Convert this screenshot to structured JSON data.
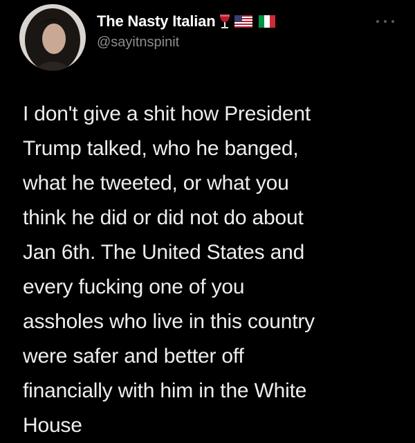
{
  "user": {
    "display_name": "The Nasty Italian",
    "handle": "@sayitnspinit",
    "name_emojis": [
      "wine-glass-icon",
      "us-flag-icon",
      "italy-flag-icon"
    ]
  },
  "tweet": {
    "lines": [
      "I don't give a shit how President",
      "Trump talked, who he banged,",
      "what he tweeted, or what you",
      "think he did or did not do about",
      "Jan 6th. The United States and",
      "every fucking one of you",
      "assholes who live in this country",
      "were safer and better off",
      "financially with him in the White",
      "House"
    ]
  },
  "colors": {
    "background": "#000000",
    "text": "#eeeeee",
    "handle": "#8a8d91"
  }
}
